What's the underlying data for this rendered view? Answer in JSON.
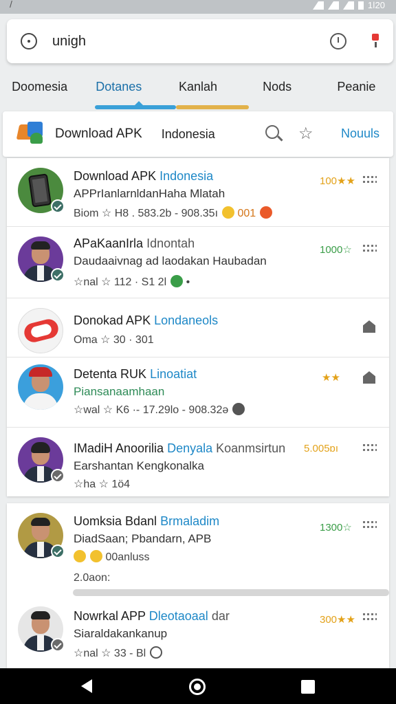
{
  "status_bar": {
    "left_glyph": "/",
    "time": "1ǀ20"
  },
  "search": {
    "query": "unigh"
  },
  "tabs": [
    {
      "label": "Doomesia"
    },
    {
      "label": "Dotanes"
    },
    {
      "label": "Kanlah"
    },
    {
      "label": "Nods"
    },
    {
      "label": "Peanie"
    }
  ],
  "appbar": {
    "title": "Download APK",
    "subtitle": "Indonesia",
    "link": "Nouuls"
  },
  "list": [
    {
      "name": "Download APK",
      "tag": "Indonesia",
      "line2": "APPrIanlarnldanHaha Mlatah",
      "line3": "Biom ☆ H8 .  583.2b - 908.35ı",
      "line3b": "001",
      "rating": "100★★"
    },
    {
      "name": "APaKaanIrla",
      "tag": "Idnontah",
      "line2": "Daudaaivnag ad laodakan Haubadan",
      "line3": "☆nal ☆ 112 ·  S1 2l",
      "line3b": "•",
      "rating": "1000☆"
    },
    {
      "name": "Donokad APK",
      "tag": "Londaneols",
      "line2": "",
      "line3": "Oma ☆ 30 ·  301",
      "line3b": "",
      "rating": ""
    },
    {
      "name": "Detenta RUK",
      "tag": "Linoatiat",
      "line2": "Piansanaamhaan",
      "line3": "☆wal ☆ K6 ·- 17.29lo - 908.32ə",
      "line3b": "",
      "rating": "★★"
    },
    {
      "name": "IMadiH Anoorilia",
      "tag": "Denyala",
      "tag2": "Koanmsirtun",
      "line2": "Earshantan Kengkonalka",
      "line3": "☆ha ☆ 1ö4",
      "line3b": "",
      "rating": "5.005ɒı"
    },
    {
      "name": "Uomksia Bdanl",
      "tag": "Brmaladim",
      "line2": "DiadSaan; Pbandarn, APB",
      "line3": "00anluss",
      "line3b": "2.0aon:",
      "rating": "1300☆"
    },
    {
      "name": "Nowrkal APP",
      "tag": "Dleotaoaal",
      "tag2": "dar",
      "line2": "Siaraldakankanup",
      "line3": "☆nal ☆ 33 -  Bl",
      "line3b": "",
      "rating": "300★★"
    }
  ],
  "colors": {
    "accent": "#1e88c7",
    "rating": "#e3a21a",
    "green": "#3a9d48"
  }
}
